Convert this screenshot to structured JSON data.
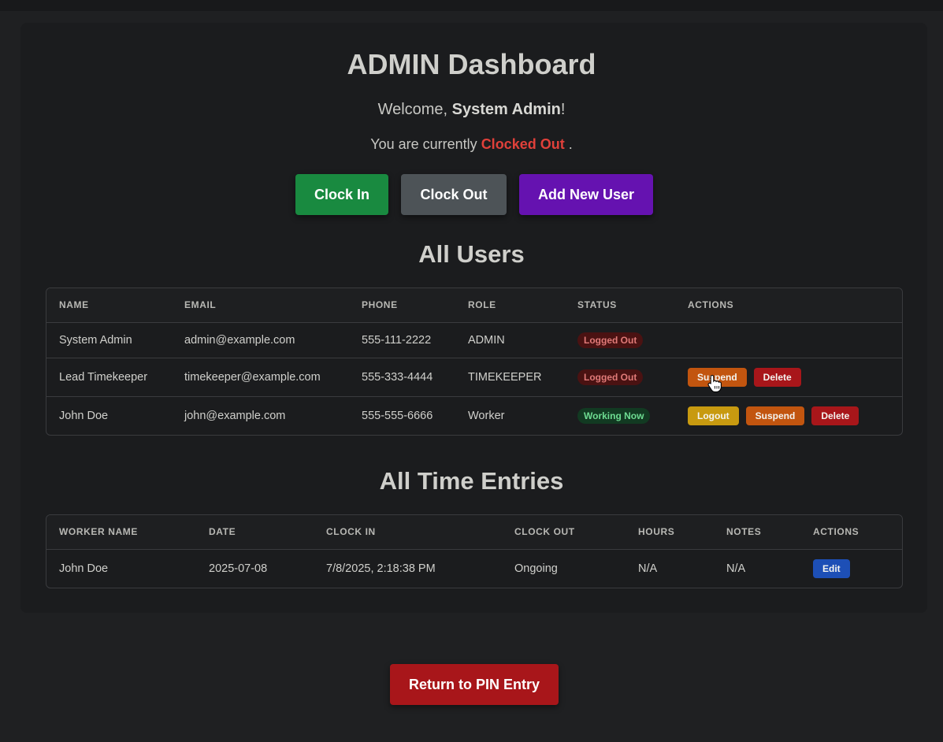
{
  "header": {
    "title": "ADMIN Dashboard",
    "welcome_prefix": "Welcome, ",
    "user_name": "System Admin",
    "welcome_suffix": "!",
    "status_prefix": "You are currently ",
    "status_value": "Clocked Out",
    "status_suffix": " ."
  },
  "actions": {
    "clock_in": "Clock In",
    "clock_out": "Clock Out",
    "add_user": "Add New User"
  },
  "users": {
    "title": "All Users",
    "columns": [
      "NAME",
      "EMAIL",
      "PHONE",
      "ROLE",
      "STATUS",
      "ACTIONS"
    ],
    "rows": [
      {
        "name": "System Admin",
        "email": "admin@example.com",
        "phone": "555-111-2222",
        "role": "ADMIN",
        "status": "Logged Out"
      },
      {
        "name": "Lead Timekeeper",
        "email": "timekeeper@example.com",
        "phone": "555-333-4444",
        "role": "TIMEKEEPER",
        "status": "Logged Out",
        "suspend": "Suspend",
        "delete": "Delete"
      },
      {
        "name": "John Doe",
        "email": "john@example.com",
        "phone": "555-555-6666",
        "role": "Worker",
        "status": "Working Now",
        "logout": "Logout",
        "suspend": "Suspend",
        "delete": "Delete"
      }
    ]
  },
  "entries": {
    "title": "All Time Entries",
    "columns": [
      "WORKER NAME",
      "DATE",
      "CLOCK IN",
      "CLOCK OUT",
      "HOURS",
      "NOTES",
      "ACTIONS"
    ],
    "rows": [
      {
        "worker": "John Doe",
        "date": "2025-07-08",
        "clock_in": "7/8/2025, 2:18:38 PM",
        "clock_out": "Ongoing",
        "hours": "N/A",
        "notes": "N/A",
        "edit": "Edit"
      }
    ]
  },
  "footer": {
    "return_label": "Return to PIN Entry"
  },
  "colors": {
    "clock_in": "#198a40",
    "clock_out": "#4d5357",
    "add_user": "#6512b0",
    "return": "#a8161a",
    "clocked_out_text": "#e0403a"
  }
}
